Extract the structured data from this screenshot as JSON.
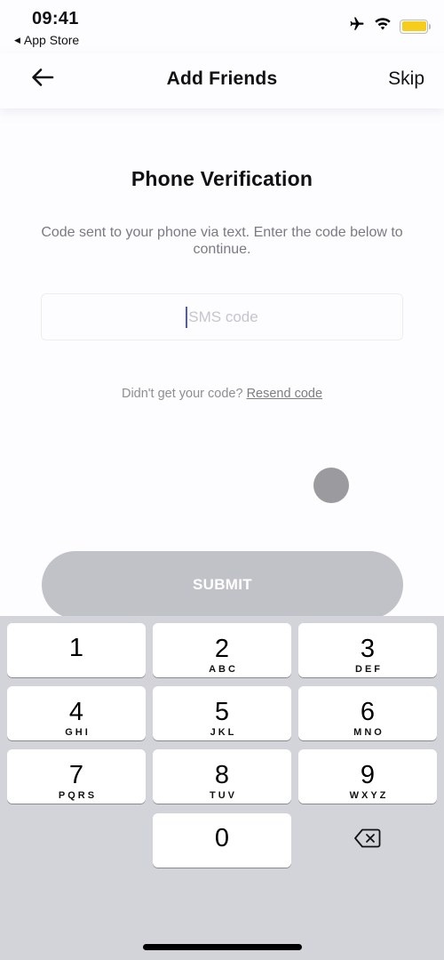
{
  "status_bar": {
    "time": "09:41",
    "back_app": "App Store",
    "icons": [
      "airplane-icon",
      "wifi-icon",
      "battery-icon"
    ],
    "battery_color": "#f5cd1a"
  },
  "nav": {
    "back_icon": "arrow-left-icon",
    "title": "Add Friends",
    "skip_label": "Skip"
  },
  "content": {
    "heading": "Phone Verification",
    "subtext": "Code sent to your phone via text. Enter the code below to continue.",
    "sms_input": {
      "value": "",
      "placeholder": "SMS code",
      "caret_color": "#4b57d6"
    },
    "resend_prompt": "Didn't get your code?",
    "resend_link": "Resend code",
    "submit_label": "SUBMIT",
    "submit_color": "#c1c1c8"
  },
  "keyboard": {
    "keys": [
      {
        "num": "1",
        "letters": ""
      },
      {
        "num": "2",
        "letters": "ABC"
      },
      {
        "num": "3",
        "letters": "DEF"
      },
      {
        "num": "4",
        "letters": "GHI"
      },
      {
        "num": "5",
        "letters": "JKL"
      },
      {
        "num": "6",
        "letters": "MNO"
      },
      {
        "num": "7",
        "letters": "PQRS"
      },
      {
        "num": "8",
        "letters": "TUV"
      },
      {
        "num": "9",
        "letters": "WXYZ"
      },
      {
        "num": "0",
        "letters": ""
      }
    ],
    "delete_icon": "backspace-icon"
  }
}
